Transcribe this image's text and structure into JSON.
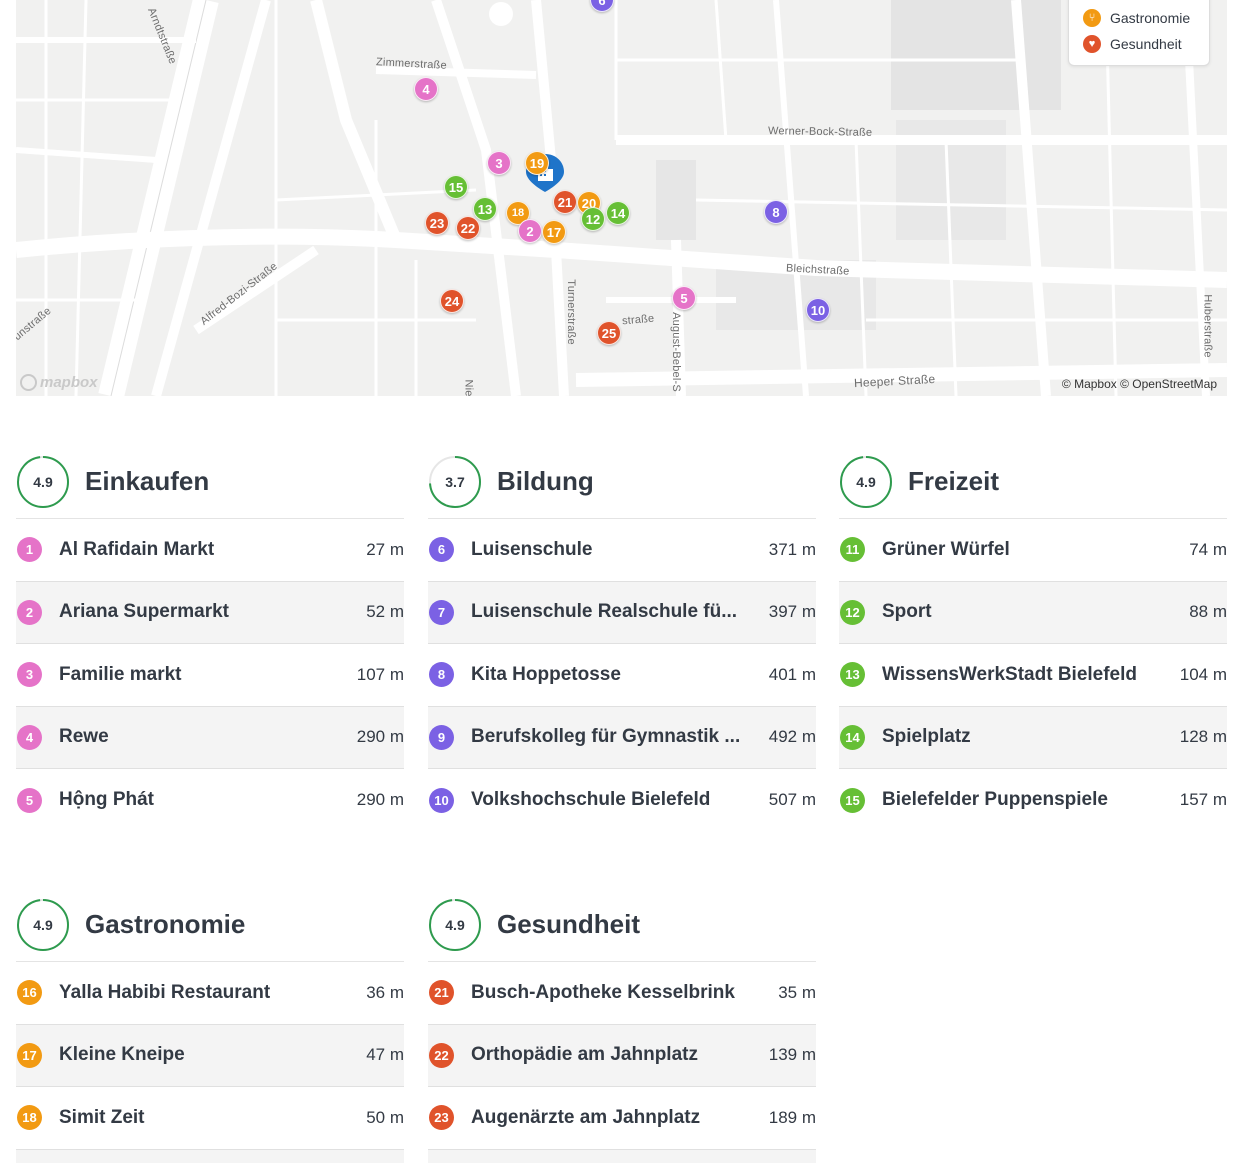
{
  "map": {
    "attribution": "© Mapbox © OpenStreetMap",
    "logo_text": "mapbox",
    "streets": [
      "Arndtstraße",
      "Zimmerstraße",
      "Werner-Bock-Straße",
      "Alfred-Bozi-Straße",
      "Bleichstraße",
      "Turnerstraße",
      "August-Bebel-S",
      "straße",
      "Heeper Straße",
      "Huberstraße",
      "unstraße",
      "Nie"
    ],
    "legend": [
      {
        "label": "Gastronomie",
        "icon": "fork-knife-icon",
        "color": "#f29a12"
      },
      {
        "label": "Gesundheit",
        "icon": "heart-icon",
        "color": "#e0532b"
      }
    ],
    "markers": [
      {
        "n": "6",
        "cat": "bildung"
      },
      {
        "n": "4",
        "cat": "einkaufen"
      },
      {
        "n": "3",
        "cat": "einkaufen"
      },
      {
        "n": "19",
        "cat": "gastro"
      },
      {
        "n": "15",
        "cat": "freizeit"
      },
      {
        "n": "13",
        "cat": "freizeit"
      },
      {
        "n": "18",
        "cat": "gastro"
      },
      {
        "n": "21",
        "cat": "gesund"
      },
      {
        "n": "20",
        "cat": "gastro"
      },
      {
        "n": "12",
        "cat": "freizeit"
      },
      {
        "n": "14",
        "cat": "freizeit"
      },
      {
        "n": "23",
        "cat": "gesund"
      },
      {
        "n": "22",
        "cat": "gesund"
      },
      {
        "n": "2",
        "cat": "einkaufen"
      },
      {
        "n": "17",
        "cat": "gastro"
      },
      {
        "n": "8",
        "cat": "bildung"
      },
      {
        "n": "24",
        "cat": "gesund"
      },
      {
        "n": "5",
        "cat": "einkaufen"
      },
      {
        "n": "25",
        "cat": "gesund"
      },
      {
        "n": "10",
        "cat": "bildung"
      }
    ]
  },
  "colors": {
    "einkaufen": "#e573c8",
    "bildung": "#7b61e4",
    "freizeit": "#66bf35",
    "gastro": "#f29a12",
    "gesund": "#e0532b",
    "score_ring": "#2e9b4e"
  },
  "categories": {
    "einkaufen": {
      "title": "Einkaufen",
      "score": "4.9",
      "score_fraction": 0.98,
      "items": [
        {
          "n": "1",
          "name": "Al Rafidain Markt",
          "dist": "27 m"
        },
        {
          "n": "2",
          "name": "Ariana Supermarkt",
          "dist": "52 m"
        },
        {
          "n": "3",
          "name": "Familie markt",
          "dist": "107 m"
        },
        {
          "n": "4",
          "name": "Rewe",
          "dist": "290 m"
        },
        {
          "n": "5",
          "name": "Hộng Phát",
          "dist": "290 m"
        }
      ]
    },
    "bildung": {
      "title": "Bildung",
      "score": "3.7",
      "score_fraction": 0.74,
      "items": [
        {
          "n": "6",
          "name": "Luisenschule",
          "dist": "371 m"
        },
        {
          "n": "7",
          "name": "Luisenschule Realschule fü...",
          "dist": "397 m"
        },
        {
          "n": "8",
          "name": "Kita Hoppetosse",
          "dist": "401 m"
        },
        {
          "n": "9",
          "name": "Berufskolleg für Gymnastik ...",
          "dist": "492 m"
        },
        {
          "n": "10",
          "name": "Volkshochschule Bielefeld",
          "dist": "507 m"
        }
      ]
    },
    "freizeit": {
      "title": "Freizeit",
      "score": "4.9",
      "score_fraction": 0.98,
      "items": [
        {
          "n": "11",
          "name": "Grüner Würfel",
          "dist": "74 m"
        },
        {
          "n": "12",
          "name": "Sport",
          "dist": "88 m"
        },
        {
          "n": "13",
          "name": "WissensWerkStadt Bielefeld",
          "dist": "104 m"
        },
        {
          "n": "14",
          "name": "Spielplatz",
          "dist": "128 m"
        },
        {
          "n": "15",
          "name": "Bielefelder Puppenspiele",
          "dist": "157 m"
        }
      ]
    },
    "gastronomie": {
      "title": "Gastronomie",
      "score": "4.9",
      "score_fraction": 0.98,
      "items": [
        {
          "n": "16",
          "name": "Yalla Habibi Restaurant",
          "dist": "36 m"
        },
        {
          "n": "17",
          "name": "Kleine Kneipe",
          "dist": "47 m"
        },
        {
          "n": "18",
          "name": "Simit Zeit",
          "dist": "50 m"
        }
      ]
    },
    "gesundheit": {
      "title": "Gesundheit",
      "score": "4.9",
      "score_fraction": 0.98,
      "items": [
        {
          "n": "21",
          "name": "Busch-Apotheke Kesselbrink",
          "dist": "35 m"
        },
        {
          "n": "22",
          "name": "Orthopädie am Jahnplatz",
          "dist": "139 m"
        },
        {
          "n": "23",
          "name": "Augenärzte am Jahnplatz",
          "dist": "189 m"
        }
      ]
    }
  }
}
